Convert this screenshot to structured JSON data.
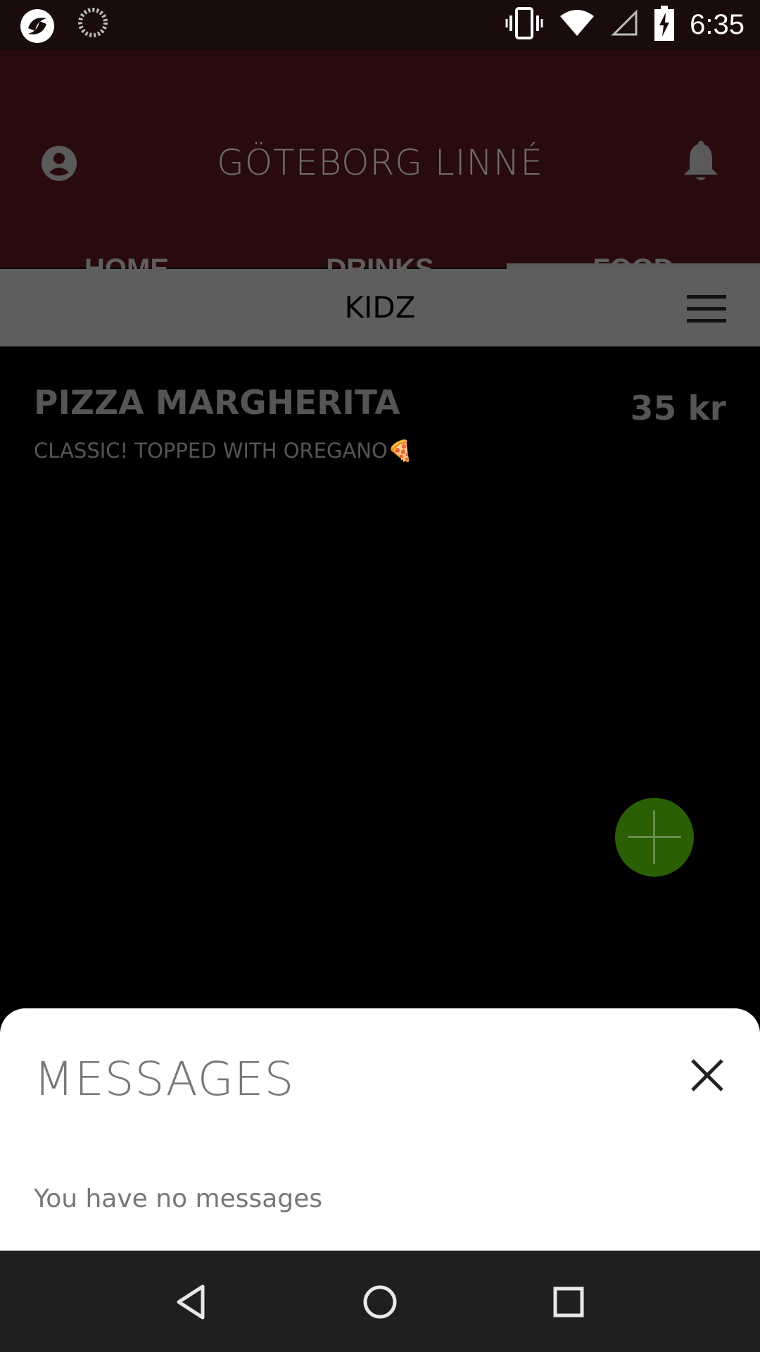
{
  "status_bar": {
    "time": "6:35",
    "icons": [
      "app-notification-icon",
      "loading-icon",
      "vibrate-icon",
      "wifi-icon",
      "signal-icon",
      "battery-charging-icon"
    ]
  },
  "header": {
    "title": "GÖTEBORG LINNÉ",
    "profile_icon": "account-circle-icon",
    "notification_icon": "bell-icon"
  },
  "tabs": [
    {
      "label": "HOME",
      "selected": false
    },
    {
      "label": "DRINKS",
      "selected": false
    },
    {
      "label": "FOOD",
      "selected": true
    }
  ],
  "subcategory": {
    "title": "KIDZ",
    "menu_icon": "hamburger-menu-icon"
  },
  "menu_items": [
    {
      "name": "PIZZA MARGHERITA",
      "description": "CLASSIC! TOPPED WITH OREGANO🍕",
      "price": "35 kr"
    }
  ],
  "fab": {
    "icon": "plus-icon",
    "color": "#2a5f04"
  },
  "messages": {
    "title": "MESSAGES",
    "empty_text": "You have no messages",
    "close_icon": "close-icon"
  },
  "nav_bar": {
    "buttons": [
      "back-icon",
      "home-icon",
      "recents-icon"
    ]
  },
  "colors": {
    "header_bg": "#2a0b0d",
    "subcategory_bg": "#5e5e5e",
    "sheet_bg": "#ffffff",
    "nav_bg": "#1d1f21"
  }
}
